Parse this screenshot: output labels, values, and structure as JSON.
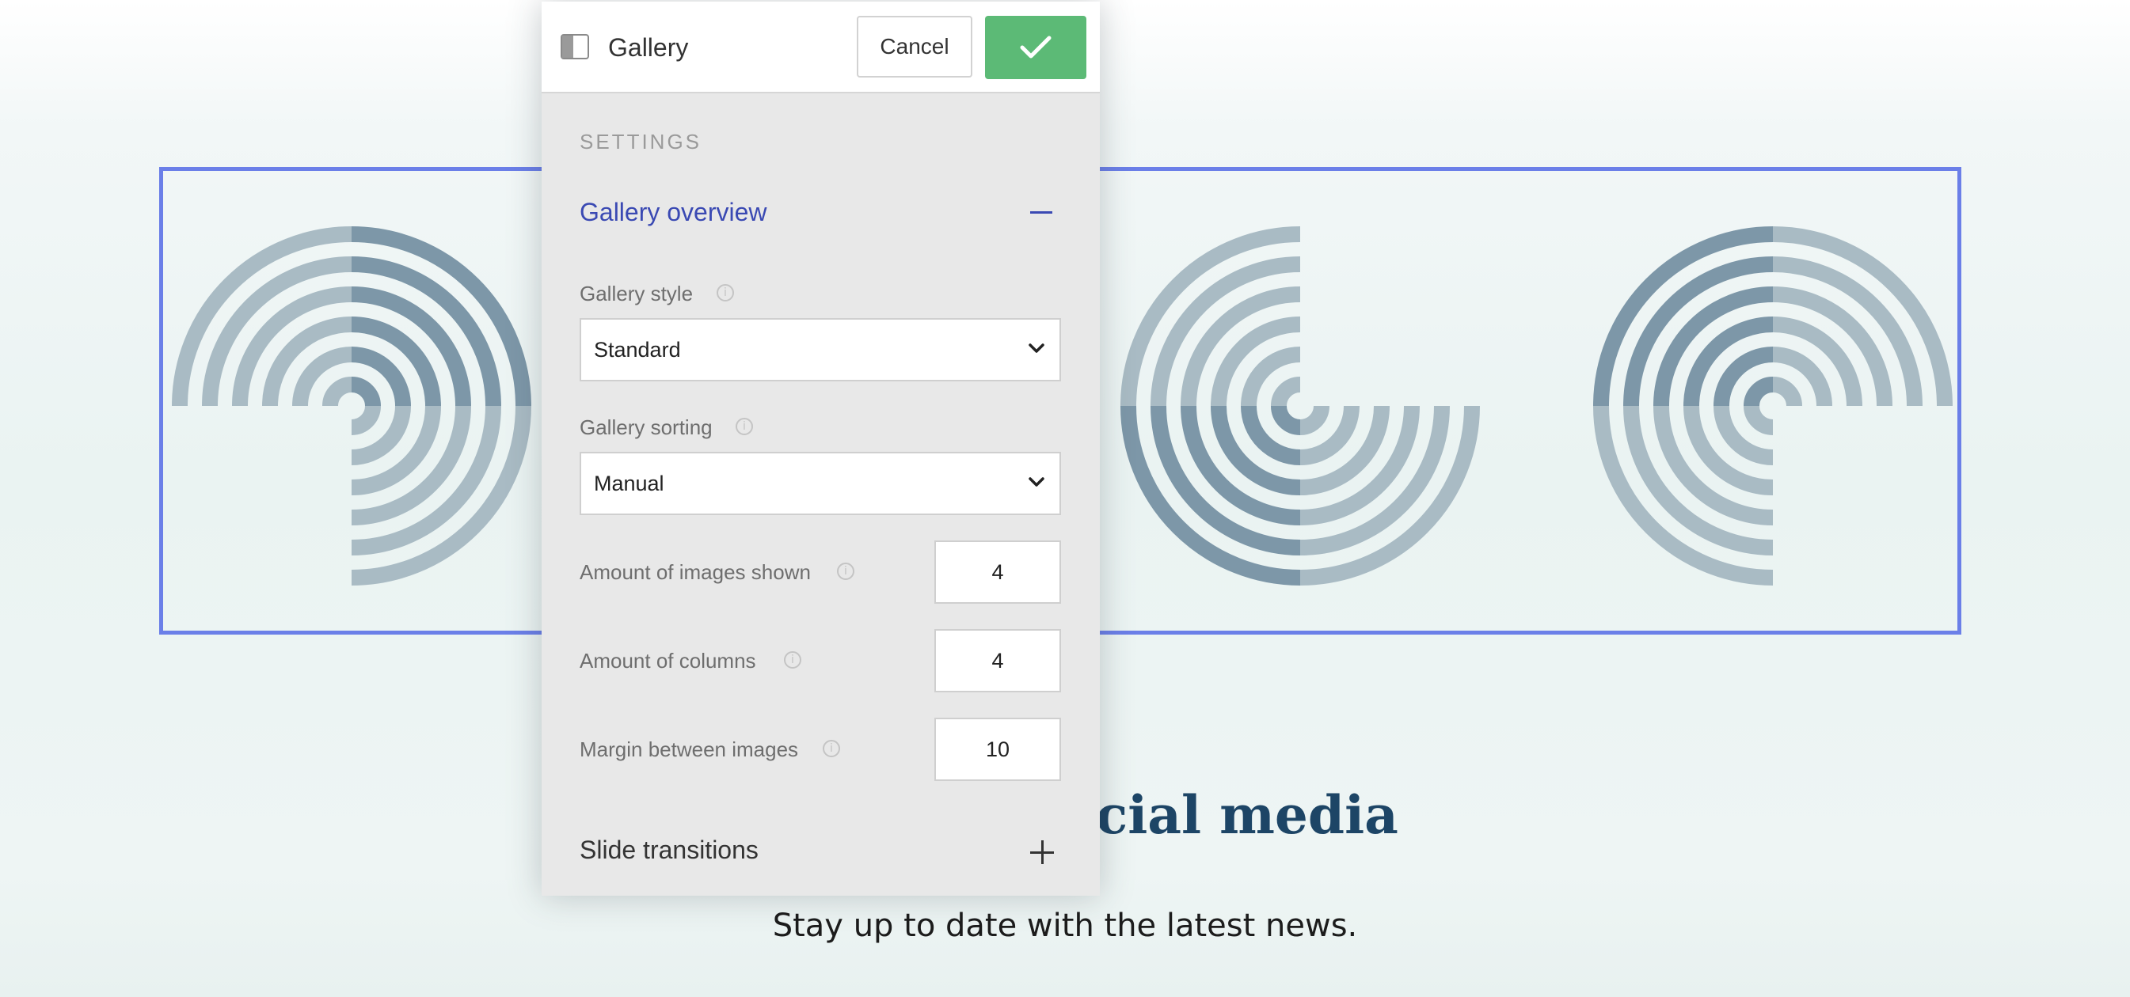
{
  "background": {
    "heading": "ocial media",
    "subtext": "Stay up to date with the latest news."
  },
  "panel": {
    "title": "Gallery",
    "cancel_label": "Cancel",
    "settings_label": "SETTINGS",
    "overview_title": "Gallery overview",
    "style": {
      "label": "Gallery style",
      "value": "Standard"
    },
    "sorting": {
      "label": "Gallery sorting",
      "value": "Manual"
    },
    "images_shown": {
      "label": "Amount of images shown",
      "value": "4"
    },
    "columns": {
      "label": "Amount of columns",
      "value": "4"
    },
    "margin": {
      "label": "Margin between images",
      "value": "10"
    },
    "transitions_title": "Slide transitions"
  },
  "colors": {
    "accent_blue": "#3a49b3",
    "confirm_green": "#5cba76",
    "selection_border": "#6b7fe8",
    "heading_navy": "#1d4566"
  }
}
